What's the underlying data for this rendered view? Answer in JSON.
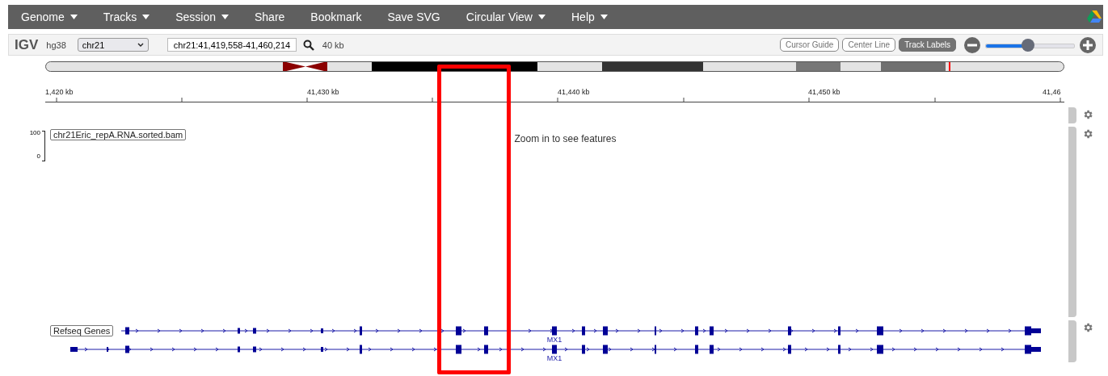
{
  "menu": [
    {
      "label": "Genome",
      "caret": true
    },
    {
      "label": "Tracks",
      "caret": true
    },
    {
      "label": "Session",
      "caret": true
    },
    {
      "label": "Share",
      "caret": false
    },
    {
      "label": "Bookmark",
      "caret": false
    },
    {
      "label": "Save SVG",
      "caret": false
    },
    {
      "label": "Circular View",
      "caret": true
    },
    {
      "label": "Help",
      "caret": true
    }
  ],
  "toolbar": {
    "logo": "IGV",
    "genome": "hg38",
    "chromosome": "chr21",
    "locus": "chr21:41,419,558-41,460,214",
    "width": "40 kb",
    "toggles": [
      {
        "label": "Cursor Guide",
        "selected": false
      },
      {
        "label": "Center Line",
        "selected": false
      },
      {
        "label": "Track Labels",
        "selected": true
      }
    ],
    "zoom": {
      "level": 0.48
    }
  },
  "ruler": {
    "labels": [
      "1,420 kb",
      "41,430 kb",
      "41,440 kb",
      "41,450 kb",
      "41,46"
    ]
  },
  "tracks": [
    {
      "kind": "alignment",
      "name": "chr21Eric_repA.RNA.sorted.bam",
      "scale_max": "100",
      "scale_min": "0",
      "message": "Zoom in to see features"
    },
    {
      "kind": "annotation",
      "name": "Refseq Genes",
      "features": [
        {
          "label": "MX1"
        },
        {
          "label": "MX1"
        }
      ]
    }
  ]
}
